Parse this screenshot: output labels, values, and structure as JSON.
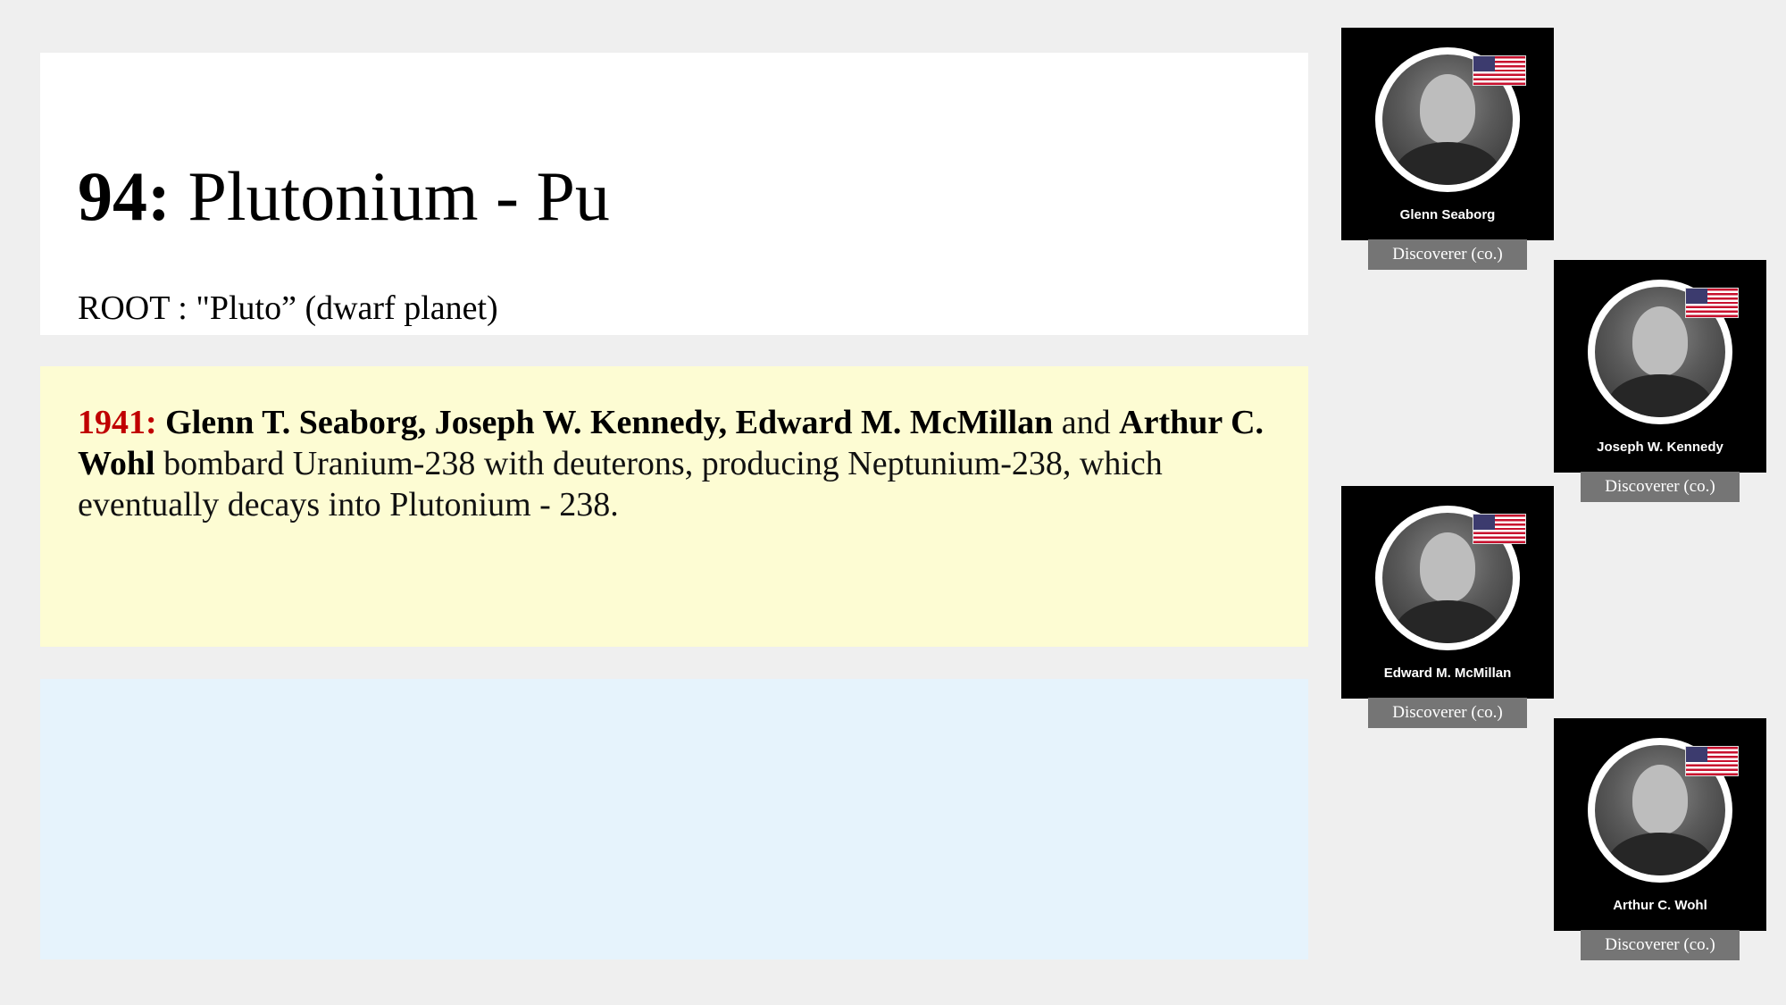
{
  "element": {
    "number_label": "94:",
    "name_label": "Plutonium - Pu",
    "root_line": "ROOT : \"Pluto” (dwarf planet)"
  },
  "history": {
    "year": "1941:",
    "names": [
      "Glenn T. Seaborg,",
      "Joseph W. Kennedy,",
      "Edward M. McMillan",
      "Arthur C. Wohl"
    ],
    "connector": "and",
    "description": "bombard Uranium-238 with deuterons, producing Neptunium-238, which eventually decays into Plutonium - 238."
  },
  "discoverers": [
    {
      "name": "Glenn Seaborg",
      "role": "Discoverer (co.)",
      "flag_icon": "us-flag-icon"
    },
    {
      "name": "Joseph W. Kennedy",
      "role": "Discoverer (co.)",
      "flag_icon": "us-flag-icon"
    },
    {
      "name": "Edward M. McMillan",
      "role": "Discoverer (co.)",
      "flag_icon": "us-flag-icon"
    },
    {
      "name": "Arthur C. Wohl",
      "role": "Discoverer (co.)",
      "flag_icon": "us-flag-icon"
    }
  ],
  "colors": {
    "year_accent": "#c00000",
    "history_background": "#fdfcd3",
    "lower_panel_background": "#e6f3fc",
    "badge_background": "#757575"
  }
}
